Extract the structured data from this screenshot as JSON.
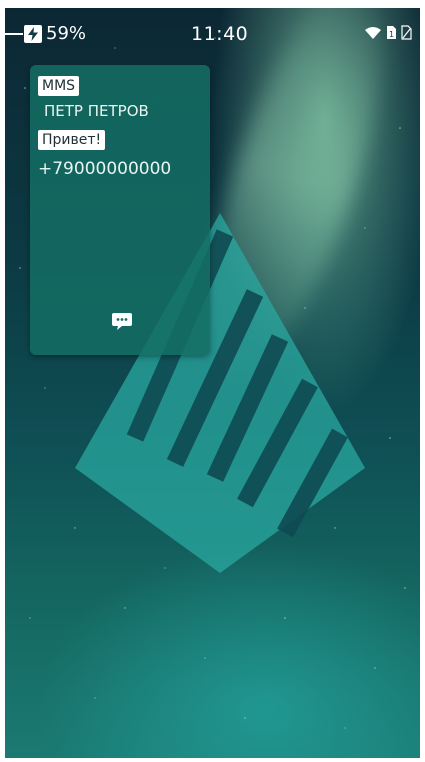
{
  "status_bar": {
    "battery_percent": "59%",
    "time": "11:40",
    "icons": [
      "battery-charging-icon",
      "wifi-icon",
      "sim1-icon",
      "sim2-icon"
    ]
  },
  "notification": {
    "type_tag": "MMS",
    "sender_name": "ПЕТР ПЕТРОВ",
    "message_tag": "Привет!",
    "phone_number": "+79000000000",
    "action_icon": "chat-bubble-icon"
  },
  "wallpaper": {
    "logo": "company-logo"
  },
  "colors": {
    "wallpaper_top": "#0c2734",
    "wallpaper_bottom": "#1a7a72",
    "notification_bg": "#146e64",
    "logo": "#2aa8a0"
  }
}
